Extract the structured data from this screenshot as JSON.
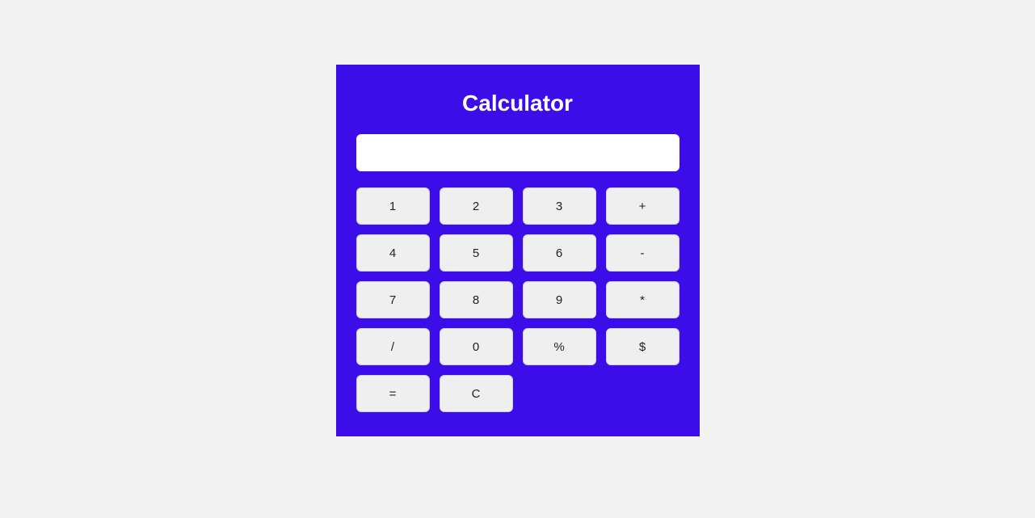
{
  "title": "Calculator",
  "display_value": "",
  "buttons": {
    "b1": "1",
    "b2": "2",
    "b3": "3",
    "plus": "+",
    "b4": "4",
    "b5": "5",
    "b6": "6",
    "minus": "-",
    "b7": "7",
    "b8": "8",
    "b9": "9",
    "multiply": "*",
    "divide": "/",
    "b0": "0",
    "percent": "%",
    "dollar": "$",
    "equals": "=",
    "clear": "C"
  },
  "colors": {
    "background": "#f2f2f2",
    "panel": "#3c0ce9",
    "button_bg": "#efefef",
    "display_bg": "#ffffff"
  }
}
